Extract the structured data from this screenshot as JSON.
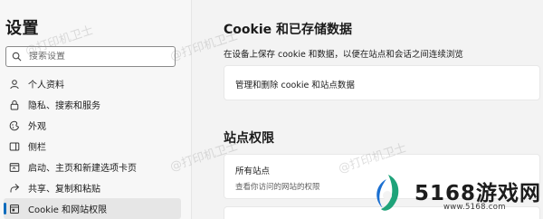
{
  "sidebar": {
    "title": "设置",
    "search_placeholder": "搜索设置",
    "items": [
      {
        "label": "个人资料",
        "icon": "profile-icon"
      },
      {
        "label": "隐私、搜索和服务",
        "icon": "lock-icon"
      },
      {
        "label": "外观",
        "icon": "appearance-icon"
      },
      {
        "label": "侧栏",
        "icon": "sidebar-icon"
      },
      {
        "label": "启动、主页和新建选项卡页",
        "icon": "power-icon"
      },
      {
        "label": "共享、复制和粘贴",
        "icon": "share-icon"
      },
      {
        "label": "Cookie 和网站权限",
        "icon": "cookie-site-icon",
        "active": true
      }
    ]
  },
  "main": {
    "cookies_section": {
      "title": "Cookie 和已存储数据",
      "description": "在设备上保存 cookie 和数据，以便在站点和会话之间连续浏览",
      "manage_label": "管理和删除 cookie 和站点数据"
    },
    "permissions_section": {
      "title": "站点权限",
      "all_sites_label": "所有站点",
      "all_sites_desc": "查看你访问的网站的权限"
    }
  },
  "watermark": {
    "text": "@打印机卫士"
  },
  "brand": {
    "name": "5168游戏网",
    "url": "www.5168.com"
  },
  "colors": {
    "accent": "#0f6cbd",
    "brand_green": "#1fa37a",
    "brand_blue": "#1a6fd1"
  }
}
